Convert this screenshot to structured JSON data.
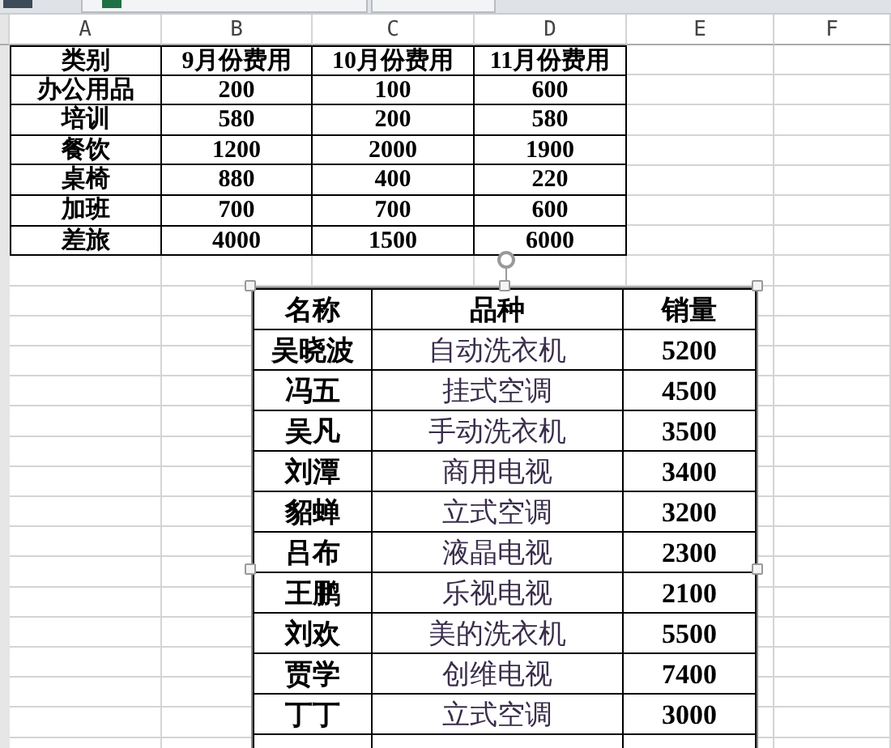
{
  "columns": [
    "A",
    "B",
    "C",
    "D",
    "E",
    "F"
  ],
  "expense_table": {
    "header": [
      "类别",
      "9月份费用",
      "10月份费用",
      "11月份费用"
    ],
    "rows": [
      [
        "办公用品",
        "200",
        "100",
        "600"
      ],
      [
        "培训",
        "580",
        "200",
        "580"
      ],
      [
        "餐饮",
        "1200",
        "2000",
        "1900"
      ],
      [
        "桌椅",
        "880",
        "400",
        "220"
      ],
      [
        "加班",
        "700",
        "700",
        "600"
      ],
      [
        "差旅",
        "4000",
        "1500",
        "6000"
      ]
    ]
  },
  "sales_picture": {
    "selected": true,
    "header": [
      "名称",
      "品种",
      "销量"
    ],
    "rows": [
      [
        "吴晓波",
        "自动洗衣机",
        "5200"
      ],
      [
        "冯五",
        "挂式空调",
        "4500"
      ],
      [
        "吴凡",
        "手动洗衣机",
        "3500"
      ],
      [
        "刘潭",
        "商用电视",
        "3400"
      ],
      [
        "貂蝉",
        "立式空调",
        "3200"
      ],
      [
        "吕布",
        "液晶电视",
        "2300"
      ],
      [
        "王鹏",
        "乐视电视",
        "2100"
      ],
      [
        "刘欢",
        "美的洗衣机",
        "5500"
      ],
      [
        "贾学",
        "创维电视",
        "7400"
      ],
      [
        "丁丁",
        "立式空调",
        "3000"
      ]
    ]
  }
}
